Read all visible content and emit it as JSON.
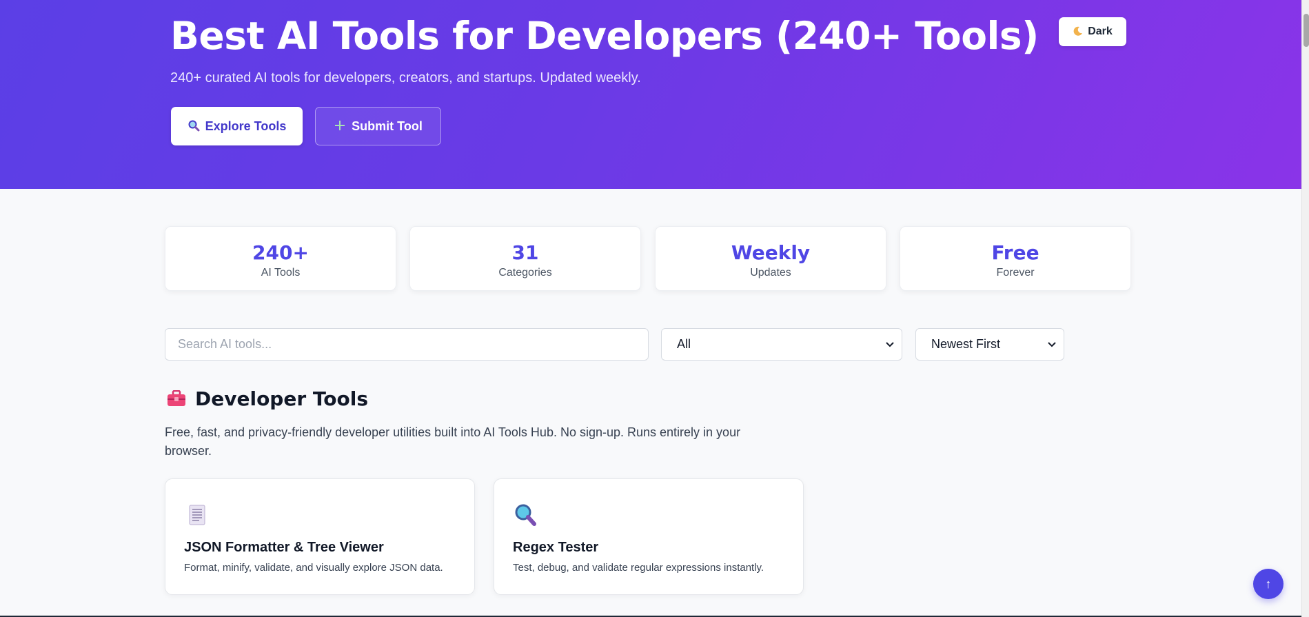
{
  "hero": {
    "title": "Best AI Tools for Developers (240+ Tools)",
    "subtitle": "240+ curated AI tools for developers, creators, and startups. Updated weekly.",
    "explore_button": {
      "icon": "magnifier-icon",
      "label": "Explore Tools"
    },
    "submit_button": {
      "icon": "plus-icon",
      "label": "Submit Tool"
    },
    "theme_toggle": {
      "icon": "moon-icon",
      "label": "Dark"
    }
  },
  "stats": [
    {
      "value": "240+",
      "label": "AI Tools"
    },
    {
      "value": "31",
      "label": "Categories"
    },
    {
      "value": "Weekly",
      "label": "Updates"
    },
    {
      "value": "Free",
      "label": "Forever"
    }
  ],
  "filters": {
    "search_placeholder": "Search AI tools...",
    "category_selected": "All",
    "sort_selected": "Newest First"
  },
  "developer_tools": {
    "icon": "toolbox-icon",
    "title": "Developer Tools",
    "description": "Free, fast, and privacy-friendly developer utilities built into AI Tools Hub. No sign-up. Runs entirely in your browser.",
    "cards": [
      {
        "icon": "document-icon",
        "title": "JSON Formatter & Tree Viewer",
        "description": "Format, minify, validate, and visually explore JSON data."
      },
      {
        "icon": "magnifier-icon",
        "title": "Regex Tester",
        "description": "Test, debug, and validate regular expressions instantly."
      }
    ]
  },
  "scroll_top": {
    "icon": "arrow-up-icon",
    "label": "↑"
  },
  "colors": {
    "hero_gradient_start": "#5b3fe6",
    "hero_gradient_end": "#8a34e8",
    "accent": "#4f46e5",
    "page_background": "#f8f9fb"
  }
}
